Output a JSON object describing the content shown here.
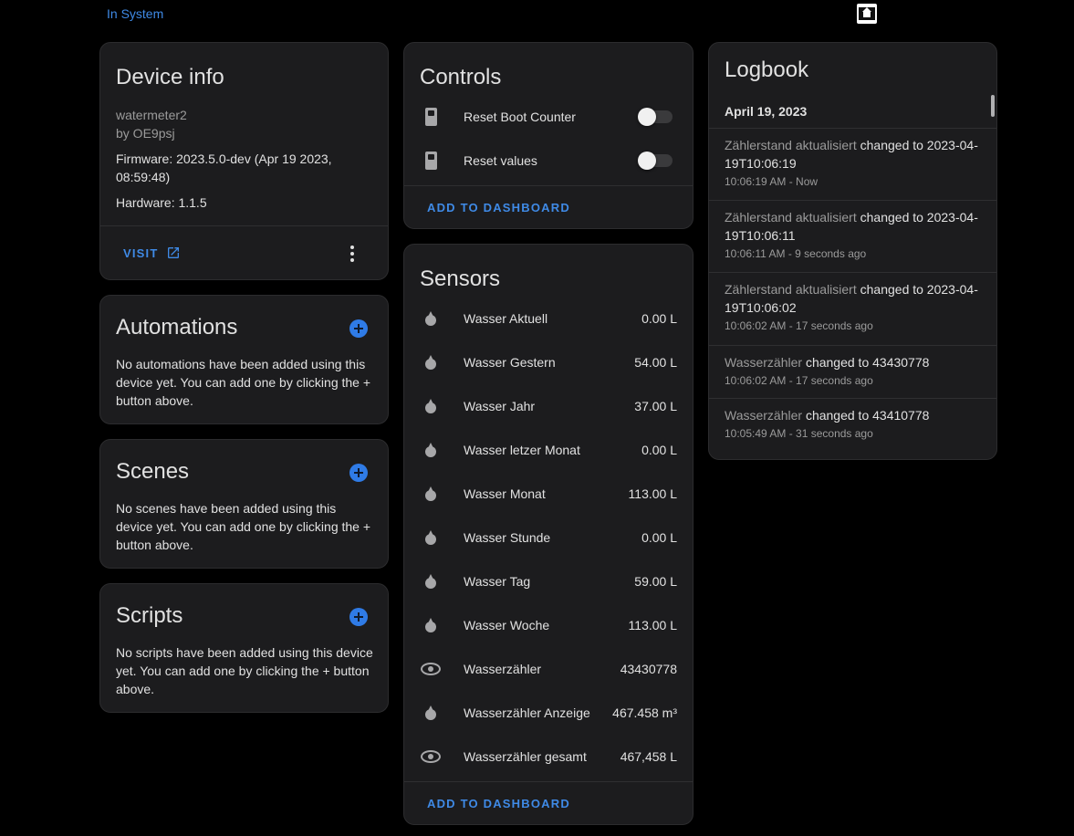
{
  "top": {
    "link_label": "In System",
    "logo_icon": "esphome-logo-icon"
  },
  "device_info": {
    "title": "Device info",
    "model": "watermeter2",
    "manufacturer": "by OE9psj",
    "firmware": "Firmware: 2023.5.0-dev (Apr 19 2023, 08:59:48)",
    "hardware": "Hardware: 1.1.5",
    "visit_label": "VISIT",
    "visit_icon": "open-in-new-icon",
    "menu_icon": "dots-vertical-icon"
  },
  "automations": {
    "title": "Automations",
    "description": "No automations have been added using this device yet. You can add one by clicking the + button above."
  },
  "scenes": {
    "title": "Scenes",
    "description": "No scenes have been added using this device yet. You can add one by clicking the + button above."
  },
  "scripts": {
    "title": "Scripts",
    "description": "No scripts have been added using this device yet. You can add one by clicking the + button above."
  },
  "controls": {
    "title": "Controls",
    "items": [
      {
        "label": "Reset Boot Counter",
        "icon": "switch-icon",
        "state": "off"
      },
      {
        "label": "Reset values",
        "icon": "switch-icon",
        "state": "off"
      }
    ],
    "add_label": "ADD TO DASHBOARD"
  },
  "sensors": {
    "title": "Sensors",
    "items": [
      {
        "label": "Wasser Aktuell",
        "value": "0.00 L",
        "icon": "water-drop-icon"
      },
      {
        "label": "Wasser Gestern",
        "value": "54.00 L",
        "icon": "water-drop-icon"
      },
      {
        "label": "Wasser Jahr",
        "value": "37.00 L",
        "icon": "water-drop-icon"
      },
      {
        "label": "Wasser letzer Monat",
        "value": "0.00 L",
        "icon": "water-drop-icon"
      },
      {
        "label": "Wasser Monat",
        "value": "113.00 L",
        "icon": "water-drop-icon"
      },
      {
        "label": "Wasser Stunde",
        "value": "0.00 L",
        "icon": "water-drop-icon"
      },
      {
        "label": "Wasser Tag",
        "value": "59.00 L",
        "icon": "water-drop-icon"
      },
      {
        "label": "Wasser Woche",
        "value": "113.00 L",
        "icon": "water-drop-icon"
      },
      {
        "label": "Wasserzähler",
        "value": "43430778",
        "icon": "eye-icon"
      },
      {
        "label": "Wasserzähler Anzeige",
        "value": "467.458 m³",
        "icon": "water-drop-icon"
      },
      {
        "label": "Wasserzähler gesamt",
        "value": "467,458 L",
        "icon": "eye-icon"
      }
    ],
    "add_label": "ADD TO DASHBOARD"
  },
  "logbook": {
    "title": "Logbook",
    "date": "April 19, 2023",
    "entries": [
      {
        "entity": "Zählerstand aktualisiert",
        "change": " changed to 2023-04-19T10:06:19",
        "time": "10:06:19 AM - Now"
      },
      {
        "entity": "Zählerstand aktualisiert",
        "change": " changed to 2023-04-19T10:06:11",
        "time": "10:06:11 AM - 9 seconds ago"
      },
      {
        "entity": "Zählerstand aktualisiert",
        "change": " changed to 2023-04-19T10:06:02",
        "time": "10:06:02 AM - 17 seconds ago"
      },
      {
        "entity": "Wasserzähler",
        "change": " changed to 43430778",
        "time": "10:06:02 AM - 17 seconds ago"
      },
      {
        "entity": "Wasserzähler",
        "change": " changed to 43410778",
        "time": "10:05:49 AM - 31 seconds ago"
      }
    ]
  },
  "colors": {
    "accent": "#3f8ae6",
    "card_bg": "#1c1c1e",
    "page_bg": "#000000"
  }
}
